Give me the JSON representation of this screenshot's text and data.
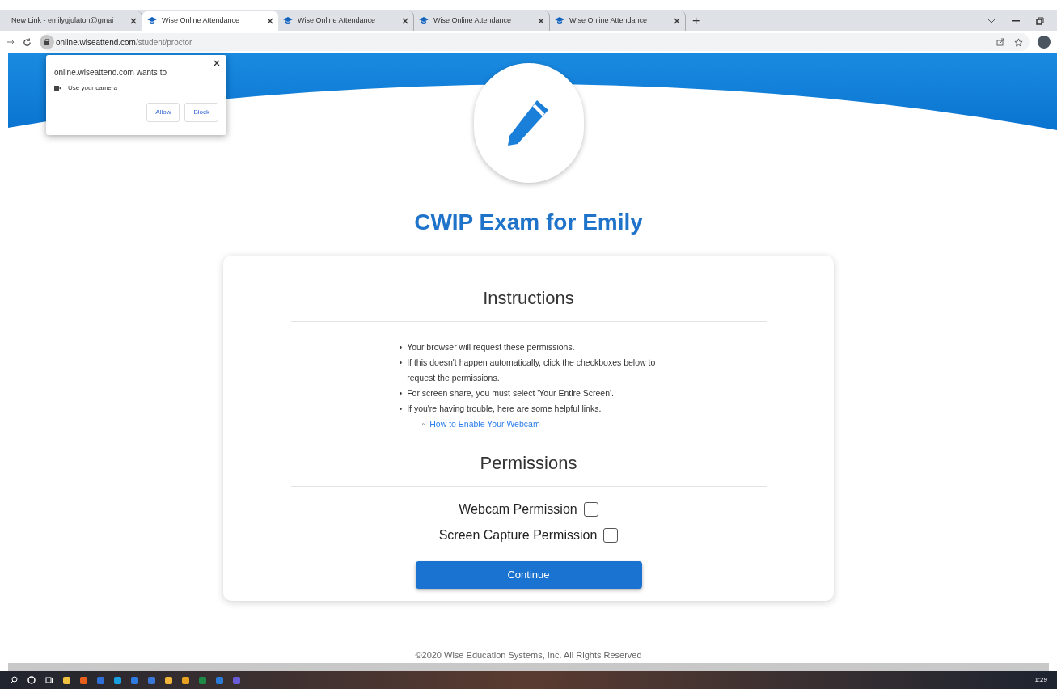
{
  "browser": {
    "tabs": [
      {
        "label": "New Link - emilygjulaton@gmai",
        "selected": false,
        "has_logo": false
      },
      {
        "label": "Wise Online Attendance",
        "selected": true,
        "has_logo": true
      },
      {
        "label": "Wise Online Attendance",
        "selected": false,
        "has_logo": true
      },
      {
        "label": "Wise Online Attendance",
        "selected": false,
        "has_logo": true
      },
      {
        "label": "Wise Online Attendance",
        "selected": false,
        "has_logo": true
      }
    ],
    "new_tab": "+",
    "url_host": "online.wiseattend.com",
    "url_path": "/student/proctor"
  },
  "permission_popup": {
    "title": "online.wiseattend.com wants to",
    "request": "Use your camera",
    "buttons": [
      "Allow",
      "Block"
    ]
  },
  "page": {
    "title": "CWIP Exam for Emily",
    "instructions_heading": "Instructions",
    "instructions": [
      "Your browser will request these permissions.",
      "If this doesn't happen automatically, click the checkboxes below to request the permissions.",
      "For screen share, you must select 'Your Entire Screen'.",
      "If you're having trouble, here are some helpful links."
    ],
    "bullet": "•",
    "link_bullet": "◦",
    "links": [
      "How to Enable Your Webcam"
    ],
    "permissions_heading": "Permissions",
    "permissions": [
      {
        "label": "Webcam Permission",
        "checked": false
      },
      {
        "label": "Screen Capture Permission",
        "checked": false
      }
    ],
    "continue": "Continue",
    "footer": "©2020 Wise Education Systems, Inc. All Rights Reserved"
  },
  "taskbar": {
    "apps": [
      {
        "color": "#f0c040"
      },
      {
        "color": "#e8601c"
      },
      {
        "color": "#2f6fd8"
      },
      {
        "color": "#1aa0e0"
      },
      {
        "color": "#2d7be0"
      },
      {
        "color": "#3a78d8"
      },
      {
        "color": "#f2b43a"
      },
      {
        "color": "#e8a020"
      },
      {
        "color": "#1d8a45"
      },
      {
        "color": "#2a7ad6"
      },
      {
        "color": "#6a5bd8"
      }
    ],
    "clock": "1:29"
  }
}
